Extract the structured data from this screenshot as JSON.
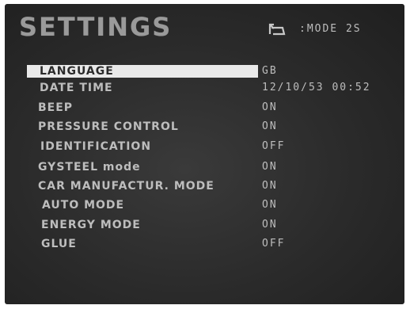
{
  "screen": {
    "title": "SETTINGS",
    "mode_icon": "mode-arrow-icon",
    "mode_label": ":MODE 2S"
  },
  "settings": [
    {
      "label": "LANGUAGE",
      "value": "GB",
      "selected": true
    },
    {
      "label": "DATE TIME",
      "value": "12/10/53 00:52",
      "selected": false
    },
    {
      "label": "BEEP",
      "value": "ON",
      "selected": false
    },
    {
      "label": "PRESSURE CONTROL",
      "value": "ON",
      "selected": false
    },
    {
      "label": "IDENTIFICATION",
      "value": "OFF",
      "selected": false
    },
    {
      "label": "GYSTEEL mode",
      "value": "ON",
      "selected": false
    },
    {
      "label": "CAR MANUFACTUR. MODE",
      "value": "ON",
      "selected": false
    },
    {
      "label": "AUTO MODE",
      "value": "ON",
      "selected": false
    },
    {
      "label": "ENERGY MODE",
      "value": "ON",
      "selected": false
    },
    {
      "label": "GLUE",
      "value": "OFF",
      "selected": false
    }
  ],
  "colors": {
    "screen_bg": "#2a2a2a",
    "text": "#bdbdbd",
    "title": "#9a9a9a",
    "selection": "#e9e9e9"
  }
}
